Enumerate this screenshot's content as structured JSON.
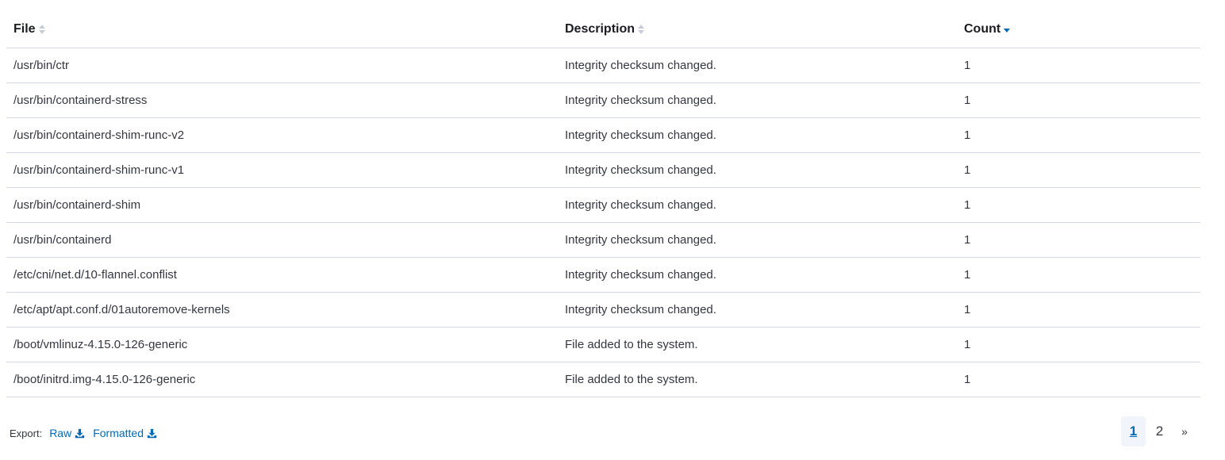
{
  "table": {
    "columns": [
      {
        "label": "File",
        "sort": "none"
      },
      {
        "label": "Description",
        "sort": "none"
      },
      {
        "label": "Count",
        "sort": "descending"
      }
    ],
    "rows": [
      {
        "file": "/usr/bin/ctr",
        "description": "Integrity checksum changed.",
        "count": "1"
      },
      {
        "file": "/usr/bin/containerd-stress",
        "description": "Integrity checksum changed.",
        "count": "1"
      },
      {
        "file": "/usr/bin/containerd-shim-runc-v2",
        "description": "Integrity checksum changed.",
        "count": "1"
      },
      {
        "file": "/usr/bin/containerd-shim-runc-v1",
        "description": "Integrity checksum changed.",
        "count": "1"
      },
      {
        "file": "/usr/bin/containerd-shim",
        "description": "Integrity checksum changed.",
        "count": "1"
      },
      {
        "file": "/usr/bin/containerd",
        "description": "Integrity checksum changed.",
        "count": "1"
      },
      {
        "file": "/etc/cni/net.d/10-flannel.conflist",
        "description": "Integrity checksum changed.",
        "count": "1"
      },
      {
        "file": "/etc/apt/apt.conf.d/01autoremove-kernels",
        "description": "Integrity checksum changed.",
        "count": "1"
      },
      {
        "file": "/boot/vmlinuz-4.15.0-126-generic",
        "description": "File added to the system.",
        "count": "1"
      },
      {
        "file": "/boot/initrd.img-4.15.0-126-generic",
        "description": "File added to the system.",
        "count": "1"
      }
    ]
  },
  "export": {
    "label": "Export:",
    "raw_label": "Raw",
    "formatted_label": "Formatted",
    "icon": "download-icon"
  },
  "pagination": {
    "pages": [
      "1",
      "2"
    ],
    "current": "1",
    "next_label": "»"
  },
  "colors": {
    "accent": "#006bb4",
    "border": "#d3dae6",
    "text": "#343741",
    "active_page_bg": "#f1f4fa"
  }
}
